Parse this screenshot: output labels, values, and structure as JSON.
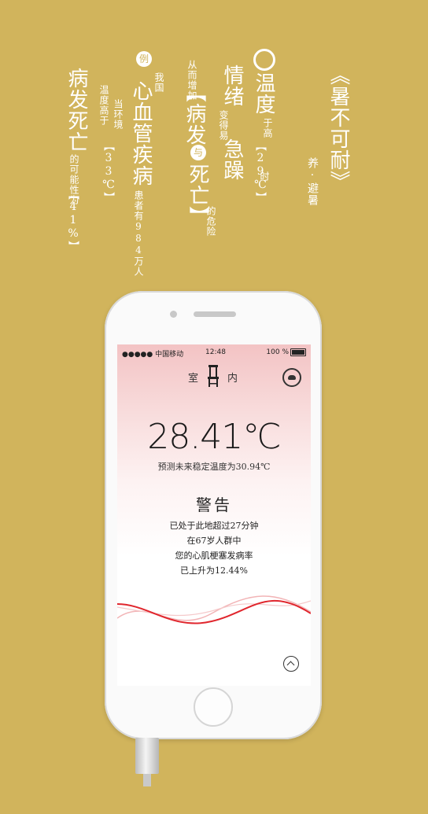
{
  "poster": {
    "title": "《暑不可耐》",
    "subtitle": "养·避暑",
    "col_temp_main": "温度",
    "col_temp_small": "于高",
    "col_temp_value": "【29℃】",
    "col_temp_time": "时",
    "col_mood_main1": "情绪",
    "col_mood_small": "变得易",
    "col_mood_main2": "急躁",
    "col_risk_small1": "从而增加",
    "col_risk_main1": "【病发",
    "col_risk_circle": "与",
    "col_risk_main2": "死亡】",
    "col_risk_small2": "的危险",
    "col_example_circle": "例",
    "col_example_small": "我国",
    "col_example_main": "心血管疾病",
    "col_example_count": "患者有984万人",
    "col_env_small1": "当环境",
    "col_env_small2": "温度高于",
    "col_env_value": "【33℃】",
    "col_death_main": "病发死亡",
    "col_death_small": "的可能性为",
    "col_death_value": "【41%】"
  },
  "app": {
    "status": {
      "carrier": "●●●●● 中国移动",
      "time": "12:48",
      "battery": "100 %"
    },
    "header": {
      "left": "室",
      "right": "内"
    },
    "temperature": "28.41℃",
    "prediction": "预测未来稳定温度为30.94℃",
    "warning": {
      "title": "警告",
      "lines": [
        "已处于此地超过27分钟",
        "在67岁人群中",
        "您的心肌梗塞发病率",
        "已上升为12.44%"
      ]
    },
    "colors": {
      "accent": "#e0262d",
      "background": "#d1b45c"
    }
  }
}
